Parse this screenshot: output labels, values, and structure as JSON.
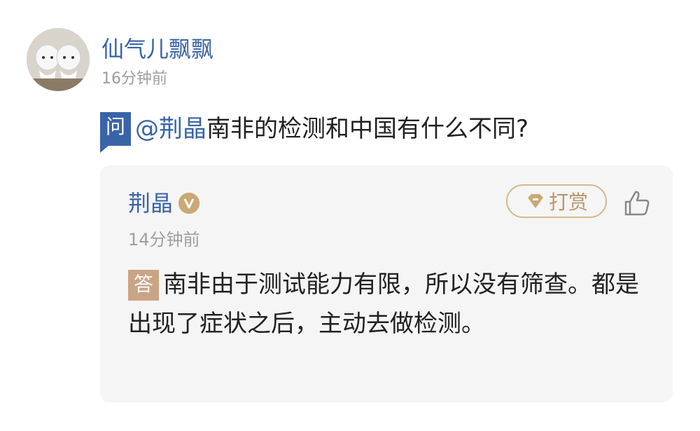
{
  "post": {
    "username": "仙气儿飘飘",
    "time": "16分钟前",
    "question_badge": "问",
    "mention": "@荆晶",
    "question_text": "南非的检测和中国有什么不同?"
  },
  "answer": {
    "name": "荆晶",
    "verified_badge": "V",
    "tip_label": "打赏",
    "time": "14分钟前",
    "answer_badge": "答",
    "text": "南非由于测试能力有限，所以没有筛查。都是出现了症状之后，主动去做检测。"
  },
  "icons": {
    "avatar": "avatar-image",
    "verified": "verified-badge-icon",
    "tip": "gem-icon",
    "like": "thumbs-up-icon"
  },
  "colors": {
    "link_blue": "#3a64a8",
    "gold": "#c9a974",
    "answer_badge": "#c9a485",
    "card_bg": "#f5f5f5",
    "muted_text": "#9e9e9e"
  }
}
